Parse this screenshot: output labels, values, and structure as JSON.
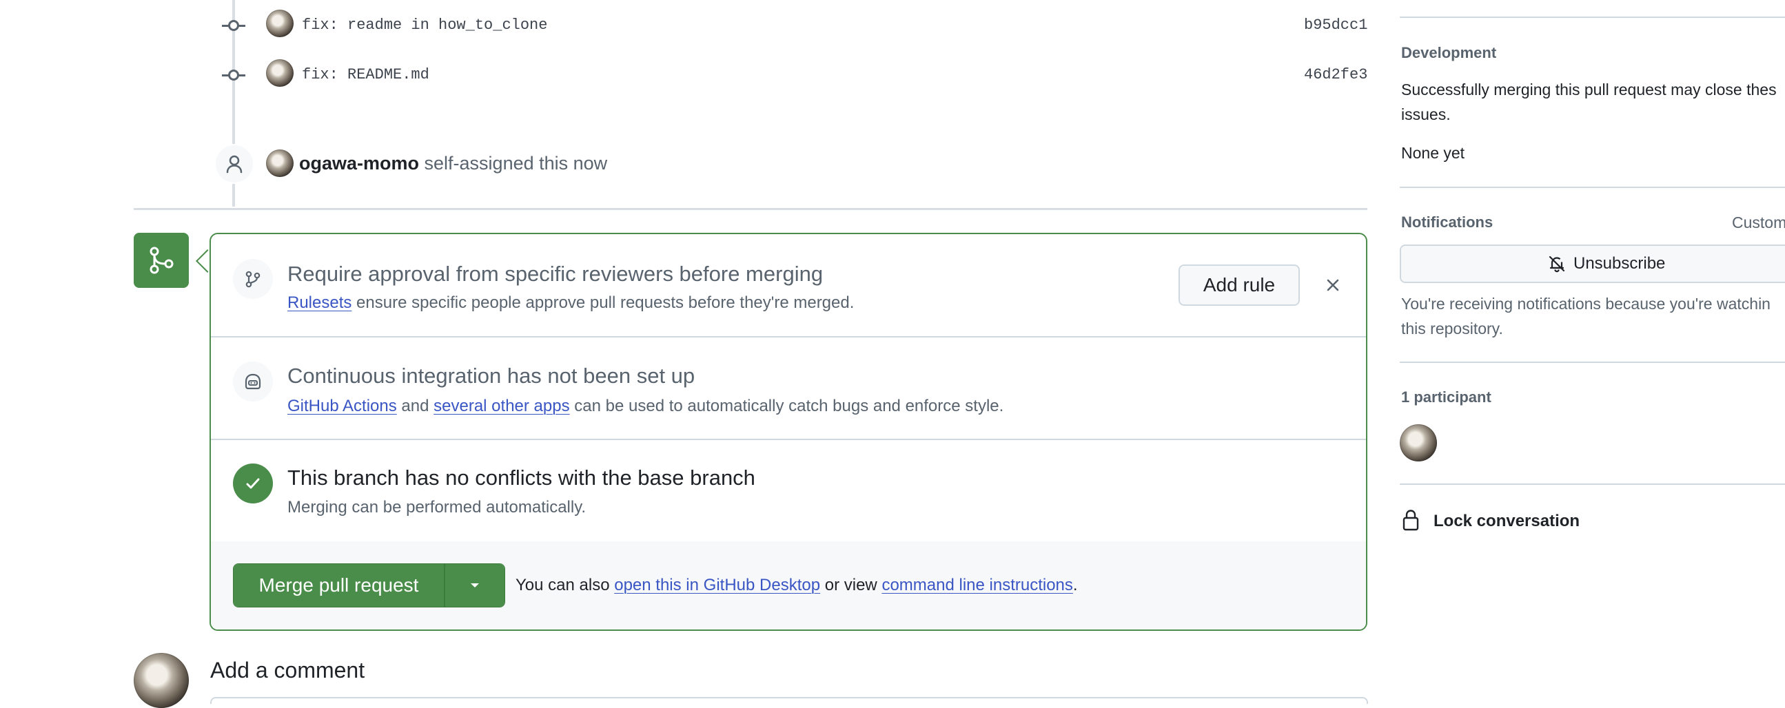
{
  "timeline": {
    "commits": [
      {
        "message": "fix: readme in how_to_clone",
        "sha": "b95dcc1"
      },
      {
        "message": "fix: README.md",
        "sha": "46d2fe3"
      }
    ],
    "assign_event": {
      "user": "ogawa-momo",
      "action": "self-assigned this now"
    }
  },
  "merge_box": {
    "rulesets": {
      "title": "Require approval from specific reviewers before merging",
      "link": "Rulesets",
      "text": "ensure specific people approve pull requests before they're merged.",
      "add_rule_label": "Add rule"
    },
    "ci": {
      "title": "Continuous integration has not been set up",
      "link1": "GitHub Actions",
      "and": "and",
      "link2": "several other apps",
      "text": "can be used to automatically catch bugs and enforce style."
    },
    "conflicts": {
      "title": "This branch has no conflicts with the base branch",
      "text": "Merging can be performed automatically."
    },
    "footer": {
      "merge_label": "Merge pull request",
      "prefix": "You can also",
      "link1": "open this in GitHub Desktop",
      "middle": "or view",
      "link2": "command line instructions",
      "suffix": "."
    }
  },
  "comment": {
    "heading": "Add a comment"
  },
  "sidebar": {
    "development": {
      "heading": "Development",
      "text_line1": "Successfully merging this pull request may close thes",
      "text_line2": "issues.",
      "none": "None yet"
    },
    "notifications": {
      "heading": "Notifications",
      "custom": "Custom",
      "unsubscribe": "Unsubscribe",
      "reason_line1": "You're receiving notifications because you're watchin",
      "reason_line2": "this repository."
    },
    "participants": {
      "heading": "1 participant"
    },
    "lock": {
      "label": "Lock conversation"
    }
  },
  "colors": {
    "merge_green": "#4a8c4a",
    "link_blue": "#3a55c4",
    "muted_text": "#59636e"
  }
}
